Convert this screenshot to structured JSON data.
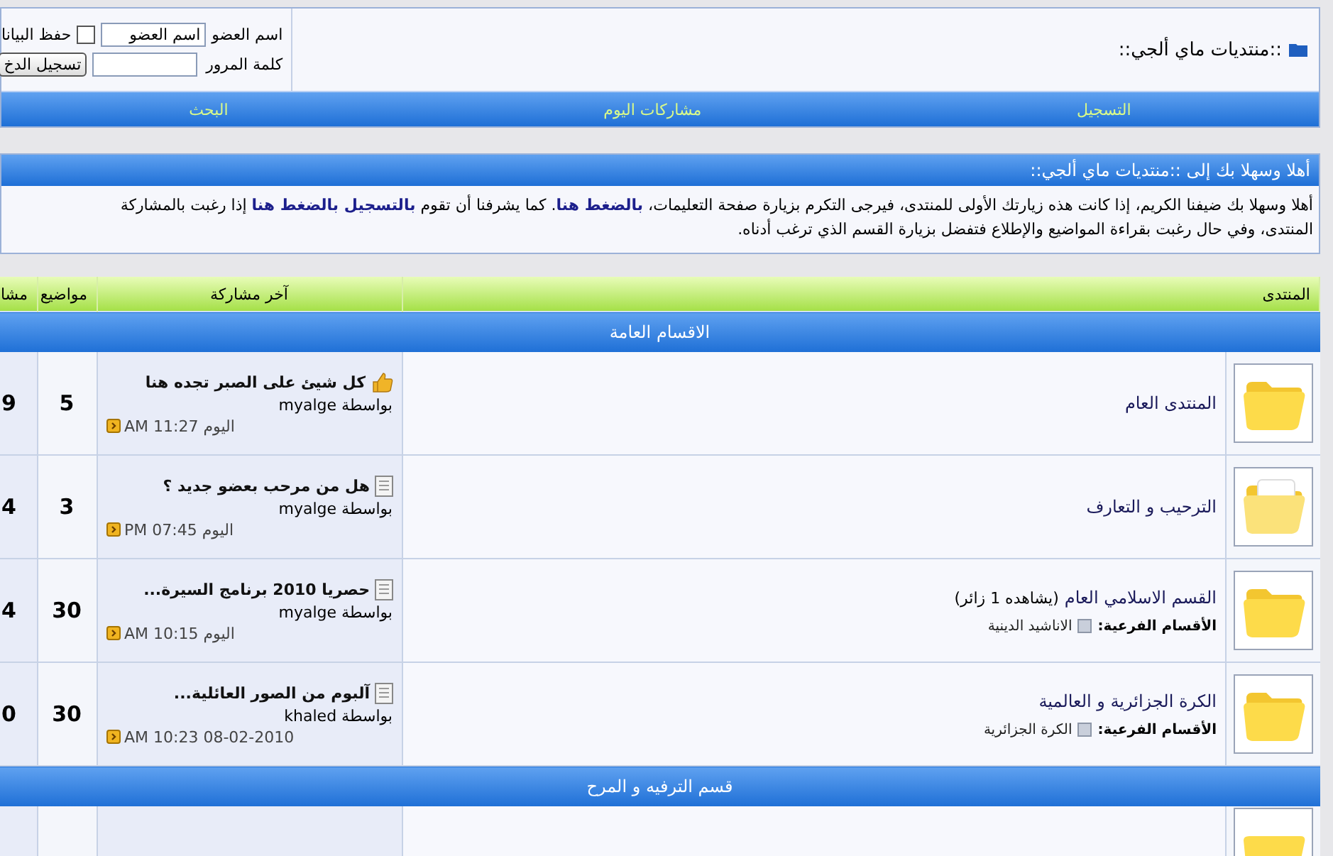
{
  "header": {
    "title": "::منتديات ماي ألجي::",
    "login": {
      "username_label": "اسم العضو",
      "username_value": "اسم العضو",
      "remember_label": "حفظ البيانا",
      "remember_checked": false,
      "password_label": "كلمة المرور",
      "login_button": "تسجيل الدخ"
    }
  },
  "navbar": [
    "التسجيل",
    "مشاركات اليوم",
    "البحث"
  ],
  "welcome": {
    "title": "أهلا وسهلا بك إلى ::منتديات ماي ألجي::",
    "lines": [
      "أهلا وسهلا بك ضيفنا الكريم، إذا كانت هذه زيارتك الأولى للمنتدى، فيرجى التكرم بزيارة صفحة التعليمات، **بالضغط هنا**. كما يشرفنا أن تقوم **بالتسجيل بالضغط هنا** إذا رغبت بالمشاركة",
      "المنتدى، وفي حال رغبت بقراءة المواضيع والإطلاع فتفضل بزيارة القسم الذي ترغب أدناه."
    ]
  },
  "table": {
    "columns": [
      "المنتدى",
      "آخر مشاركة",
      "مواضيع",
      "مشا"
    ],
    "sections": [
      {
        "title": "الاقسام العامة",
        "forums": [
          {
            "kind": "plain",
            "name": "المنتدى العام",
            "last_post": {
              "kind": "thumb",
              "title": "كل شيئ على الصبر تجده هنا",
              "by": "بواسطة myalge",
              "time": "اليوم AM 11:27"
            },
            "topics": "5",
            "posts": "9"
          },
          {
            "kind": "paper",
            "name": "الترحيب و التعارف",
            "last_post": {
              "kind": "document",
              "title": "هل من مرحب بعضو جديد ؟",
              "by": "بواسطة myalge",
              "time": "اليوم PM 07:45"
            },
            "topics": "3",
            "posts": "4"
          },
          {
            "kind": "plain",
            "name": "القسم الاسلامي العام",
            "viewers": "(يشاهده 1 زائر)",
            "subforums_label": "الأقسام الفرعية:",
            "subforums": [
              "الاناشيد الدينية"
            ],
            "last_post": {
              "kind": "document",
              "title": "حصريا 2010 برنامج السيرة...",
              "by": "بواسطة myalge",
              "time": "اليوم AM 10:15"
            },
            "topics": "30",
            "posts": "4"
          },
          {
            "kind": "plain",
            "name": "الكرة الجزائرية و العالمية",
            "subforums_label": "الأقسام الفرعية:",
            "subforums": [
              "الكرة الجزائرية"
            ],
            "last_post": {
              "kind": "document",
              "title": "آلبوم من الصور العائلية...",
              "by": "بواسطة khaled",
              "time": "08-02-2010 AM 10:23"
            },
            "topics": "30",
            "posts": "0"
          }
        ]
      },
      {
        "title": "قسم الترفيه و المرح"
      }
    ]
  }
}
